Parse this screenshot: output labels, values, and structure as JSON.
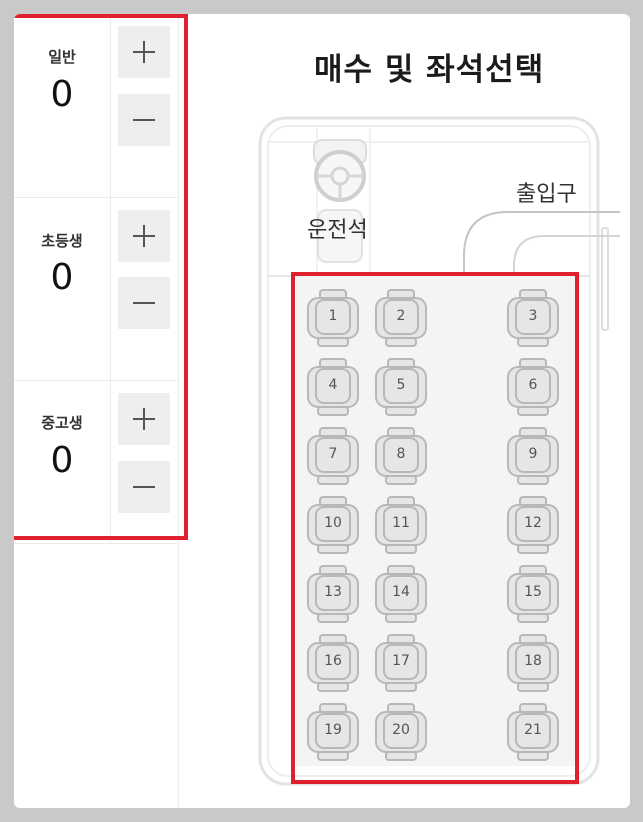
{
  "title": "매수 및 좌석선택",
  "counters": [
    {
      "label": "일반",
      "value": "0"
    },
    {
      "label": "초등생",
      "value": "0"
    },
    {
      "label": "중고생",
      "value": "0"
    }
  ],
  "bus": {
    "driver_label": "운전석",
    "entrance_label": "출입구",
    "seats": [
      "1",
      "2",
      "3",
      "4",
      "5",
      "6",
      "7",
      "8",
      "9",
      "10",
      "11",
      "12",
      "13",
      "14",
      "15",
      "16",
      "17",
      "18",
      "19",
      "20",
      "21"
    ]
  },
  "icons": {
    "increment": "plus-icon",
    "decrement": "minus-icon",
    "driver": "steering-wheel-icon",
    "entrance": "arrow-down-icon"
  },
  "colors": {
    "highlight": "#e0202e",
    "button_bg": "#eeeeee",
    "seat_fill": "#e6e6e6",
    "seat_stroke": "#b8b8b8"
  }
}
